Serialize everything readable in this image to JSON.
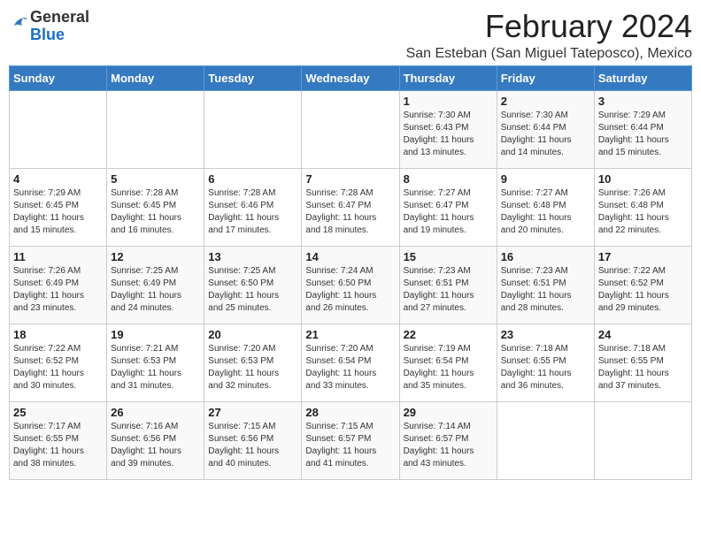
{
  "header": {
    "logo_general": "General",
    "logo_blue": "Blue",
    "month_title": "February 2024",
    "location": "San Esteban (San Miguel Tateposco), Mexico"
  },
  "days_of_week": [
    "Sunday",
    "Monday",
    "Tuesday",
    "Wednesday",
    "Thursday",
    "Friday",
    "Saturday"
  ],
  "weeks": [
    [
      {
        "day": "",
        "info": ""
      },
      {
        "day": "",
        "info": ""
      },
      {
        "day": "",
        "info": ""
      },
      {
        "day": "",
        "info": ""
      },
      {
        "day": "1",
        "info": "Sunrise: 7:30 AM\nSunset: 6:43 PM\nDaylight: 11 hours\nand 13 minutes."
      },
      {
        "day": "2",
        "info": "Sunrise: 7:30 AM\nSunset: 6:44 PM\nDaylight: 11 hours\nand 14 minutes."
      },
      {
        "day": "3",
        "info": "Sunrise: 7:29 AM\nSunset: 6:44 PM\nDaylight: 11 hours\nand 15 minutes."
      }
    ],
    [
      {
        "day": "4",
        "info": "Sunrise: 7:29 AM\nSunset: 6:45 PM\nDaylight: 11 hours\nand 15 minutes."
      },
      {
        "day": "5",
        "info": "Sunrise: 7:28 AM\nSunset: 6:45 PM\nDaylight: 11 hours\nand 16 minutes."
      },
      {
        "day": "6",
        "info": "Sunrise: 7:28 AM\nSunset: 6:46 PM\nDaylight: 11 hours\nand 17 minutes."
      },
      {
        "day": "7",
        "info": "Sunrise: 7:28 AM\nSunset: 6:47 PM\nDaylight: 11 hours\nand 18 minutes."
      },
      {
        "day": "8",
        "info": "Sunrise: 7:27 AM\nSunset: 6:47 PM\nDaylight: 11 hours\nand 19 minutes."
      },
      {
        "day": "9",
        "info": "Sunrise: 7:27 AM\nSunset: 6:48 PM\nDaylight: 11 hours\nand 20 minutes."
      },
      {
        "day": "10",
        "info": "Sunrise: 7:26 AM\nSunset: 6:48 PM\nDaylight: 11 hours\nand 22 minutes."
      }
    ],
    [
      {
        "day": "11",
        "info": "Sunrise: 7:26 AM\nSunset: 6:49 PM\nDaylight: 11 hours\nand 23 minutes."
      },
      {
        "day": "12",
        "info": "Sunrise: 7:25 AM\nSunset: 6:49 PM\nDaylight: 11 hours\nand 24 minutes."
      },
      {
        "day": "13",
        "info": "Sunrise: 7:25 AM\nSunset: 6:50 PM\nDaylight: 11 hours\nand 25 minutes."
      },
      {
        "day": "14",
        "info": "Sunrise: 7:24 AM\nSunset: 6:50 PM\nDaylight: 11 hours\nand 26 minutes."
      },
      {
        "day": "15",
        "info": "Sunrise: 7:23 AM\nSunset: 6:51 PM\nDaylight: 11 hours\nand 27 minutes."
      },
      {
        "day": "16",
        "info": "Sunrise: 7:23 AM\nSunset: 6:51 PM\nDaylight: 11 hours\nand 28 minutes."
      },
      {
        "day": "17",
        "info": "Sunrise: 7:22 AM\nSunset: 6:52 PM\nDaylight: 11 hours\nand 29 minutes."
      }
    ],
    [
      {
        "day": "18",
        "info": "Sunrise: 7:22 AM\nSunset: 6:52 PM\nDaylight: 11 hours\nand 30 minutes."
      },
      {
        "day": "19",
        "info": "Sunrise: 7:21 AM\nSunset: 6:53 PM\nDaylight: 11 hours\nand 31 minutes."
      },
      {
        "day": "20",
        "info": "Sunrise: 7:20 AM\nSunset: 6:53 PM\nDaylight: 11 hours\nand 32 minutes."
      },
      {
        "day": "21",
        "info": "Sunrise: 7:20 AM\nSunset: 6:54 PM\nDaylight: 11 hours\nand 33 minutes."
      },
      {
        "day": "22",
        "info": "Sunrise: 7:19 AM\nSunset: 6:54 PM\nDaylight: 11 hours\nand 35 minutes."
      },
      {
        "day": "23",
        "info": "Sunrise: 7:18 AM\nSunset: 6:55 PM\nDaylight: 11 hours\nand 36 minutes."
      },
      {
        "day": "24",
        "info": "Sunrise: 7:18 AM\nSunset: 6:55 PM\nDaylight: 11 hours\nand 37 minutes."
      }
    ],
    [
      {
        "day": "25",
        "info": "Sunrise: 7:17 AM\nSunset: 6:55 PM\nDaylight: 11 hours\nand 38 minutes."
      },
      {
        "day": "26",
        "info": "Sunrise: 7:16 AM\nSunset: 6:56 PM\nDaylight: 11 hours\nand 39 minutes."
      },
      {
        "day": "27",
        "info": "Sunrise: 7:15 AM\nSunset: 6:56 PM\nDaylight: 11 hours\nand 40 minutes."
      },
      {
        "day": "28",
        "info": "Sunrise: 7:15 AM\nSunset: 6:57 PM\nDaylight: 11 hours\nand 41 minutes."
      },
      {
        "day": "29",
        "info": "Sunrise: 7:14 AM\nSunset: 6:57 PM\nDaylight: 11 hours\nand 43 minutes."
      },
      {
        "day": "",
        "info": ""
      },
      {
        "day": "",
        "info": ""
      }
    ]
  ]
}
